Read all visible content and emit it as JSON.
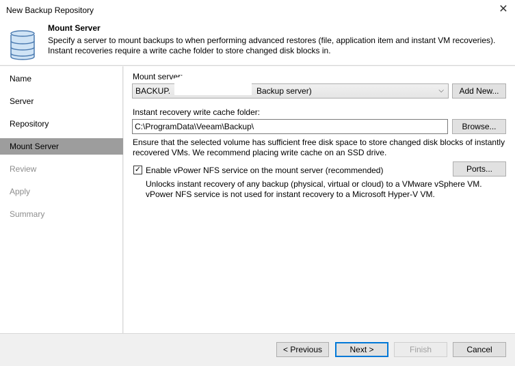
{
  "window": {
    "title": "New Backup Repository",
    "close_icon": "close-icon"
  },
  "header": {
    "title": "Mount Server",
    "description": "Specify a server to mount backups to when performing advanced restores (file, application item and instant VM recoveries). Instant recoveries require a write cache folder to store changed disk blocks in.",
    "icon": "database-icon"
  },
  "sidebar": {
    "items": [
      {
        "label": "Name",
        "state": "enabled"
      },
      {
        "label": "Server",
        "state": "enabled"
      },
      {
        "label": "Repository",
        "state": "enabled"
      },
      {
        "label": "Mount Server",
        "state": "active"
      },
      {
        "label": "Review",
        "state": "disabled"
      },
      {
        "label": "Apply",
        "state": "disabled"
      },
      {
        "label": "Summary",
        "state": "disabled"
      }
    ]
  },
  "mount_server": {
    "label": "Mount server:",
    "value_prefix": "BACKUP.",
    "value_suffix": "Backup server)",
    "add_new_label": "Add New..."
  },
  "cache_folder": {
    "label": "Instant recovery write cache folder:",
    "value": "C:\\ProgramData\\Veeam\\Backup\\",
    "browse_label": "Browse...",
    "note": "Ensure that the selected volume has sufficient free disk space to store changed disk blocks of instantly recovered VMs. We recommend placing write cache on an SSD drive."
  },
  "nfs": {
    "checked": true,
    "label": "Enable vPower NFS service on the mount server (recommended)",
    "ports_label": "Ports...",
    "description": "Unlocks instant recovery of any backup (physical, virtual or cloud) to a VMware vSphere VM. vPower NFS service is not used for instant recovery to a Microsoft Hyper-V VM."
  },
  "footer": {
    "previous_label": "< Previous",
    "next_label": "Next >",
    "finish_label": "Finish",
    "cancel_label": "Cancel"
  },
  "colors": {
    "active_nav": "#9d9d9d",
    "focus_border": "#0078d7"
  }
}
